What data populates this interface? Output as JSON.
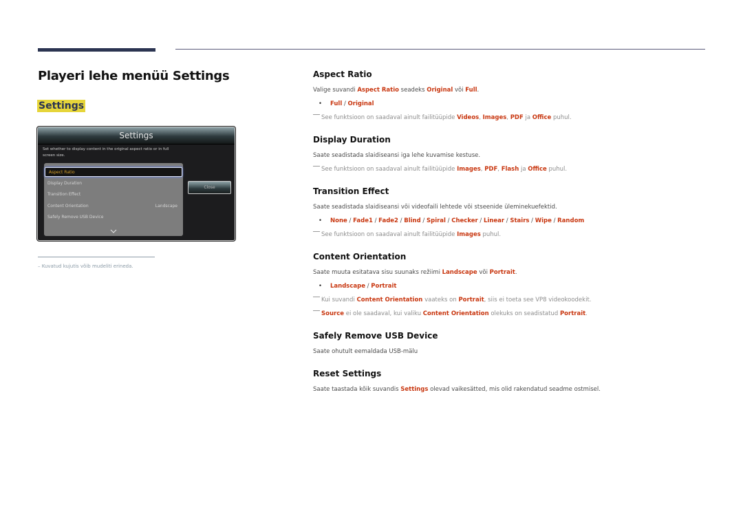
{
  "header": {
    "title": "Playeri lehe menüü Settings",
    "section_badge": "Settings"
  },
  "dialog": {
    "title": "Settings",
    "description": "Set whether to display content in the original aspect ratio or in full screen size.",
    "items": [
      {
        "label": "Aspect Ratio",
        "value": "",
        "selected": true
      },
      {
        "label": "Display Duration",
        "value": ""
      },
      {
        "label": "Transition Effect",
        "value": ""
      },
      {
        "label": "Content Orientation",
        "value": "Landscape"
      },
      {
        "label": "Safely Remove USB Device",
        "value": ""
      }
    ],
    "close_label": "Close",
    "more_icon": "chevron-down-icon"
  },
  "footnote": "Kuvatud kujutis võib mudeliti erineda.",
  "colors": {
    "accent_dark": "#2b3451",
    "highlight_yellow": "#e6d53a",
    "emphasis_red": "#c8360f"
  },
  "sections": {
    "aspect_ratio": {
      "title": "Aspect Ratio",
      "desc": {
        "t1": "Valige suvandi ",
        "h1": "Aspect Ratio",
        "t2": " seadeks ",
        "h2": "Original",
        "t3": " või ",
        "h3": "Full",
        "t4": "."
      },
      "options": [
        "Full",
        "Original"
      ],
      "note": {
        "t1": "See funktsioon on saadaval ainult failitüüpide ",
        "h1": "Videos",
        "t2": ", ",
        "h2": "Images",
        "t3": ", ",
        "h3": "PDF",
        "t4": " ja ",
        "h4": "Office",
        "t5": " puhul."
      }
    },
    "display_duration": {
      "title": "Display Duration",
      "desc": "Saate seadistada slaidiseansi iga lehe kuvamise kestuse.",
      "note": {
        "t1": "See funktsioon on saadaval ainult failitüüpide ",
        "h1": "Images",
        "t2": ", ",
        "h2": "PDF",
        "t3": ", ",
        "h3": "Flash",
        "t4": " ja ",
        "h4": "Office",
        "t5": " puhul."
      }
    },
    "transition_effect": {
      "title": "Transition Effect",
      "desc": "Saate seadistada slaidiseansi või videofaili lehtede või stseenide üleminekuefektid.",
      "options": [
        "None",
        "Fade1",
        "Fade2",
        "Blind",
        "Spiral",
        "Checker",
        "Linear",
        "Stairs",
        "Wipe",
        "Random"
      ],
      "note": {
        "t1": "See funktsioon on saadaval ainult failitüüpide ",
        "h1": "Images",
        "t2": " puhul."
      }
    },
    "content_orientation": {
      "title": "Content Orientation",
      "desc": {
        "t1": "Saate muuta esitatava sisu suunaks režiimi ",
        "h1": "Landscape",
        "t2": " või ",
        "h2": "Portrait",
        "t3": "."
      },
      "options": [
        "Landscape",
        "Portrait"
      ],
      "note1": {
        "t1": "Kui suvandi ",
        "h1": "Content Orientation",
        "t2": " vaateks on ",
        "h2": "Portrait",
        "t3": ", siis ei toeta see VP8 videokoodekit."
      },
      "note2": {
        "h1": "Source",
        "t1": " ei ole saadaval, kui valiku ",
        "h2": "Content Orientation",
        "t2": " olekuks on seadistatud ",
        "h3": "Portrait",
        "t3": "."
      }
    },
    "safely_remove": {
      "title": "Safely Remove USB Device",
      "desc": "Saate ohutult eemaldada USB-mälu"
    },
    "reset_settings": {
      "title": "Reset Settings",
      "desc": {
        "t1": "Saate taastada kõik suvandis ",
        "h1": "Settings",
        "t2": " olevad vaikesätted, mis olid rakendatud seadme ostmisel."
      }
    }
  }
}
